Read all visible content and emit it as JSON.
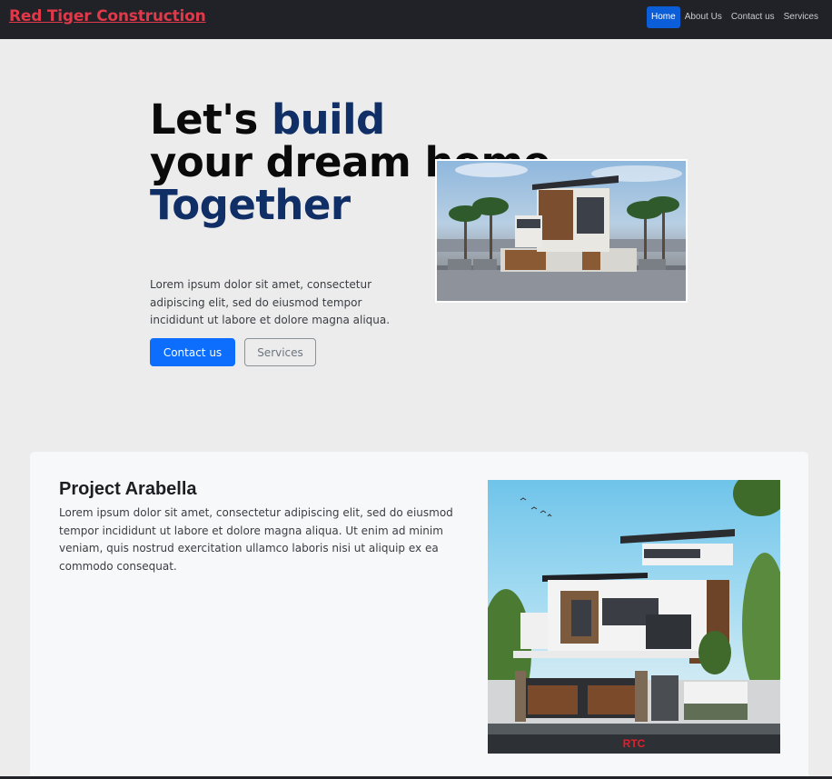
{
  "navbar": {
    "brand": "Red Tiger Construction",
    "links": [
      "Home",
      "About Us",
      "Contact us",
      "Services"
    ],
    "active": "Home"
  },
  "hero": {
    "title_part1": "Let's ",
    "title_accent1": "build",
    "title_part2": "your dream home.",
    "title_accent2": "Together",
    "text": "Lorem ipsum dolor sit amet, consectetur adipiscing elit, sed do eiusmod tempor incididunt ut labore et dolore magna aliqua.",
    "primary_button": "Contact us",
    "secondary_button": "Services"
  },
  "project": {
    "title": "Project Arabella",
    "text": "Lorem ipsum dolor sit amet, consectetur adipiscing elit, sed do eiusmod tempor incididunt ut labore et dolore magna aliqua. Ut enim ad minim veniam, quis nostrud exercitation ullamco laboris nisi ut aliquip ex ea commodo consequat.",
    "image_watermark": "RTC"
  },
  "colors": {
    "navbar_bg": "#202227",
    "brand": "#e0394a",
    "accent_title": "#0f2f66",
    "primary": "#0d6efd",
    "page_bg": "#ececec",
    "card_bg": "#f7f8fa"
  }
}
